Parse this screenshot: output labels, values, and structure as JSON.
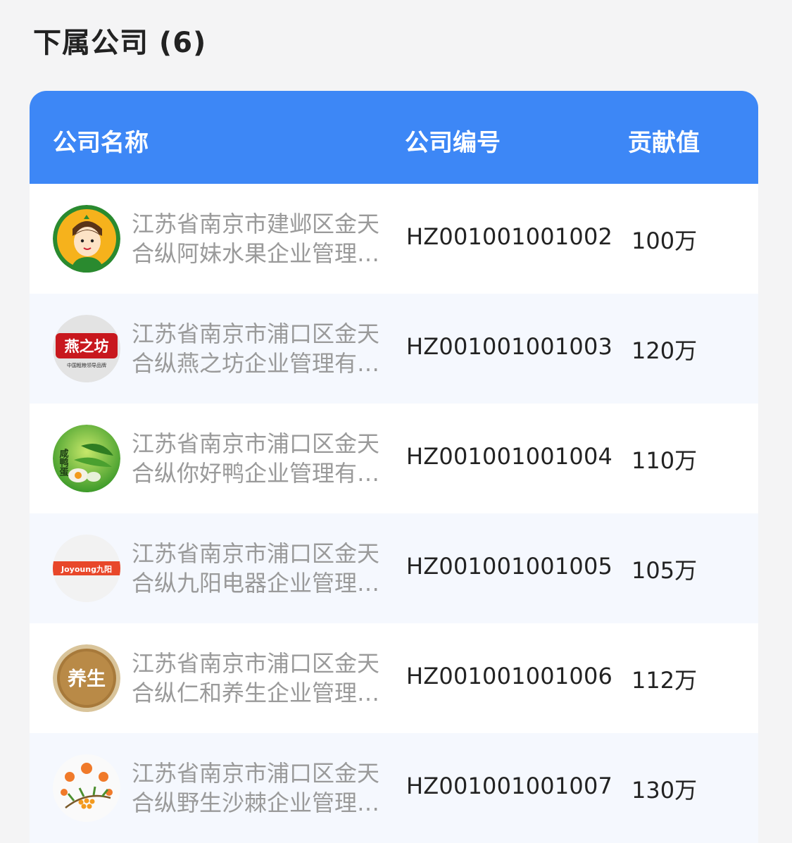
{
  "section": {
    "title": "下属公司 (6)"
  },
  "table": {
    "headers": {
      "name": "公司名称",
      "code": "公司编号",
      "value": "贡献值"
    },
    "rows": [
      {
        "name": "江苏省南京市建邺区金天合纵阿妹水果企业管理有限公司",
        "code": "HZ001001001002",
        "value": "100万",
        "logo_icon": "orange-girl-logo-icon"
      },
      {
        "name": "江苏省南京市浦口区金天合纵燕之坊企业管理有限公司",
        "code": "HZ001001001003",
        "value": "120万",
        "logo_icon": "yanzhifang-logo-icon",
        "logo_text": "燕之坊",
        "logo_subtext": "中国粗粮领导品牌"
      },
      {
        "name": "江苏省南京市浦口区金天合纵你好鸭企业管理有限公司",
        "code": "HZ001001001004",
        "value": "110万",
        "logo_icon": "salted-duck-egg-logo-icon",
        "logo_text": "咸鸭蛋"
      },
      {
        "name": "江苏省南京市浦口区金天合纵九阳电器企业管理有限公司",
        "code": "HZ001001001005",
        "value": "105万",
        "logo_icon": "joyoung-logo-icon",
        "logo_text": "Joyoung九阳"
      },
      {
        "name": "江苏省南京市浦口区金天合纵仁和养生企业管理有限公司",
        "code": "HZ001001001006",
        "value": "112万",
        "logo_icon": "yangsheng-logo-icon",
        "logo_text": "养生"
      },
      {
        "name": "江苏省南京市浦口区金天合纵野生沙棘企业管理有限公司",
        "code": "HZ001001001007",
        "value": "130万",
        "logo_icon": "sea-buckthorn-logo-icon"
      }
    ]
  },
  "colors": {
    "header_bg": "#3d87f6",
    "row_alt_bg": "#f5f8fe",
    "page_bg": "#f4f4f5"
  }
}
